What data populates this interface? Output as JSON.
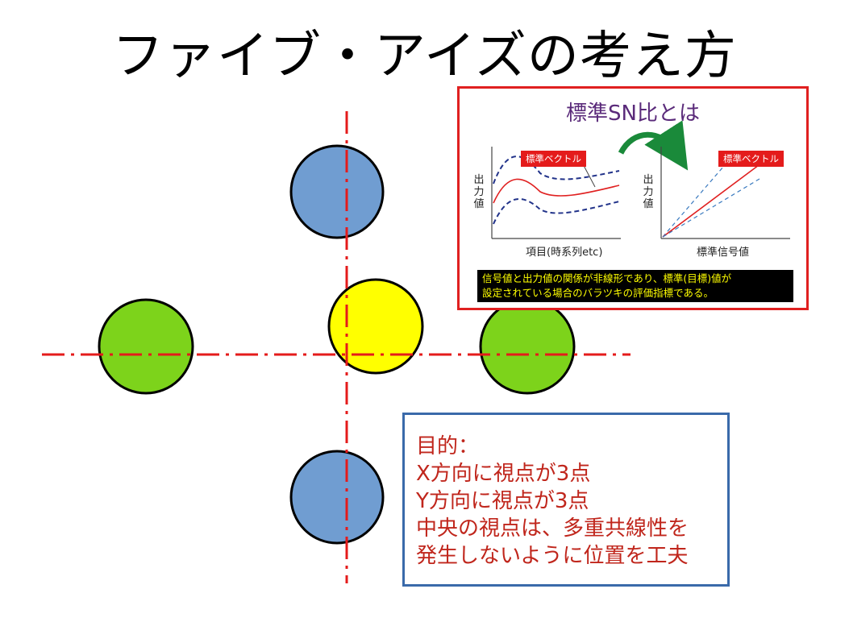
{
  "title": "ファイブ・アイズの考え方",
  "colors": {
    "crosshair": "#e41b1b",
    "blue_circle": "#709dd1",
    "green_circle": "#7dd31b",
    "yellow_circle": "#ffff00",
    "sn_border": "#e02020",
    "purpose_border": "#3a6aaa",
    "purpose_text": "#c0261c"
  },
  "sn_panel": {
    "title": "標準SN比とは",
    "left_chart": {
      "tag": "標準ベクトル",
      "y_label": "出力値",
      "x_label": "項目(時系列etc)"
    },
    "right_chart": {
      "tag": "標準ベクトル",
      "y_label": "出力値",
      "x_label": "標準信号値"
    },
    "note_lines": [
      "信号値と出力値の関係が非線形であり、標準(目標)値が",
      "設定されている場合のバラツキの評価指標である。"
    ]
  },
  "purpose": {
    "lines": [
      "目的：",
      "X方向に視点が3点",
      "Y方向に視点が3点",
      "中央の視点は、多重共線性を",
      "発生しないように位置を工夫"
    ]
  }
}
